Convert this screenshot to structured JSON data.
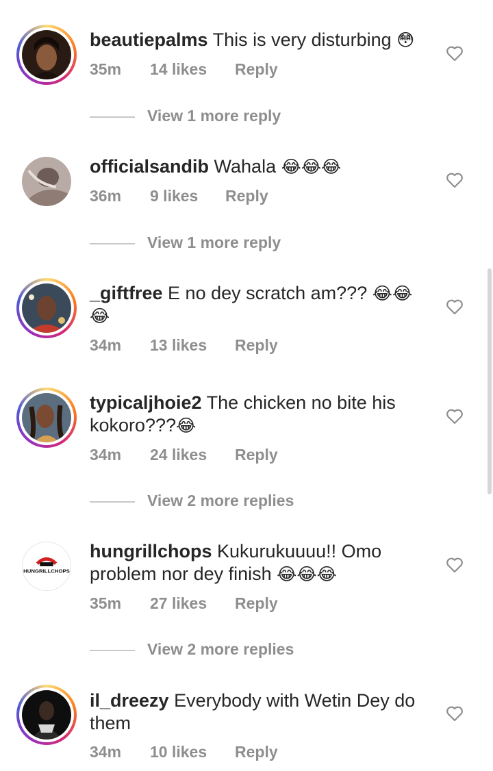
{
  "comments": [
    {
      "username": "beautiepalms",
      "text": "This is very disturbing",
      "emoji": "😳",
      "time": "35m",
      "likes": "14 likes",
      "reply": "Reply",
      "view_more": "View 1 more reply"
    },
    {
      "username": "officialsandib",
      "text": "Wahala",
      "emoji": "😂😂😂",
      "time": "36m",
      "likes": "9 likes",
      "reply": "Reply",
      "view_more": "View 1 more reply"
    },
    {
      "username": "_giftfree",
      "text": "E no dey scratch am???",
      "emoji": "😂😂",
      "emoji2": "😂",
      "time": "34m",
      "likes": "13 likes",
      "reply": "Reply"
    },
    {
      "username": "typicaljhoie2",
      "text": "The chicken no bite his",
      "text2": "kokoro???",
      "emoji": "😂",
      "time": "34m",
      "likes": "24 likes",
      "reply": "Reply",
      "view_more": "View 2 more replies"
    },
    {
      "username": "hungrillchops",
      "text": "Kukurukuuuu!! Omo",
      "text2": "problem nor dey finish",
      "emoji": "😂😂😂",
      "logo_text": "HUNGRILLCHOPS",
      "time": "35m",
      "likes": "27 likes",
      "reply": "Reply",
      "view_more": "View 2 more replies"
    },
    {
      "username": "il_dreezy",
      "text": "Everybody with Wetin Dey do",
      "text2": "them",
      "time": "34m",
      "likes": "10 likes",
      "reply": "Reply"
    }
  ],
  "icons": {
    "like": "heart-outline-icon"
  },
  "colors": {
    "text": "#262626",
    "muted": "#8e8e8e",
    "divider": "#c7c7c7"
  }
}
